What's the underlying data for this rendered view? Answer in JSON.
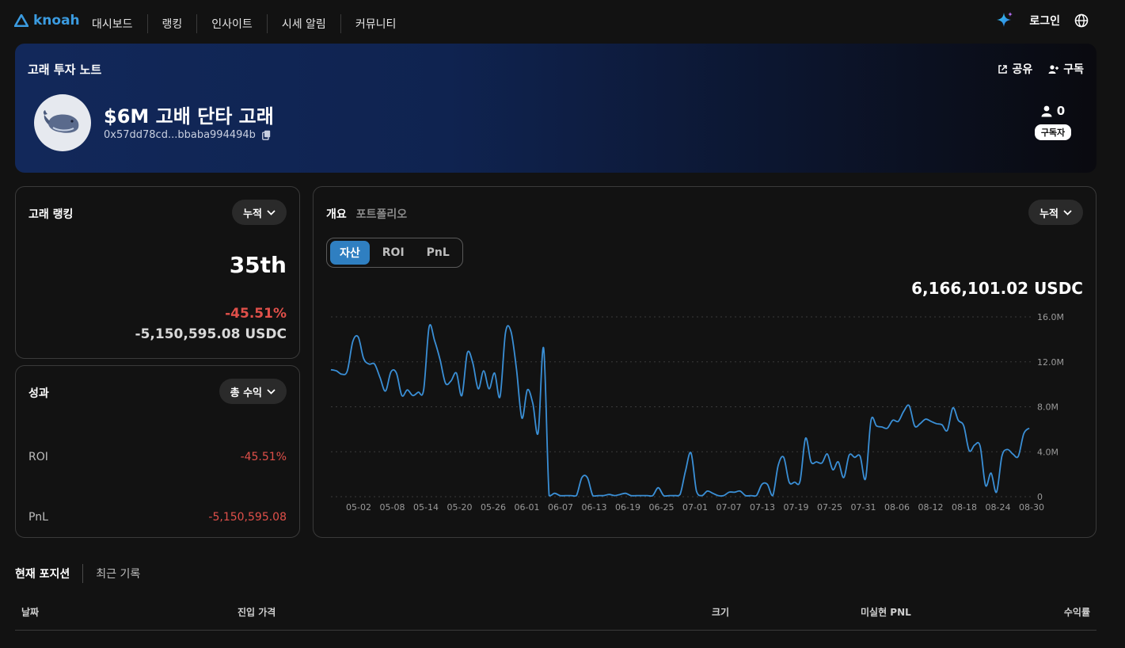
{
  "nav": {
    "brand": "knoah",
    "items": [
      "대시보드",
      "랭킹",
      "인사이트",
      "시세 알림",
      "커뮤니티"
    ],
    "login": "로그인"
  },
  "banner": {
    "title": "고래 투자 노트",
    "share": "공유",
    "subscribe": "구독",
    "whale_name": "$6M 고배 단타 고래",
    "address": "0x57dd78cd...bbaba994494b",
    "subscriber_count": "0",
    "subscriber_label": "구독자"
  },
  "ranking": {
    "title": "고래 랭킹",
    "filter": "누적",
    "rank": "35th",
    "roi": "-45.51%",
    "pnl": "-5,150,595.08 USDC"
  },
  "performance": {
    "title": "성과",
    "filter": "총 수익",
    "roi_label": "ROI",
    "roi_value": "-45.51%",
    "pnl_label": "PnL",
    "pnl_value": "-5,150,595.08"
  },
  "overview": {
    "tab_active": "개요",
    "tab_inactive": "포트폴리오",
    "filter": "누적",
    "segments": [
      "자산",
      "ROI",
      "PnL"
    ],
    "active_segment": "자산",
    "total": "6,166,101.02 USDC"
  },
  "chart_data": {
    "type": "line",
    "y_tick_labels": [
      "16.0M",
      "12.0M",
      "8.0M",
      "4.0M",
      "0"
    ],
    "y_ticks": [
      16,
      12,
      8,
      4,
      0
    ],
    "ylim": [
      0,
      16
    ],
    "x_tick_labels": [
      "05-02",
      "05-08",
      "05-14",
      "05-20",
      "05-26",
      "06-01",
      "06-07",
      "06-13",
      "06-19",
      "06-25",
      "07-01",
      "07-07",
      "07-13",
      "07-19",
      "07-25",
      "07-31",
      "08-06",
      "08-12",
      "08-18",
      "08-24",
      "08-30"
    ],
    "series": [
      {
        "values": [
          11.3,
          11.2,
          10.9,
          11.2,
          13.8,
          14.2,
          12.3,
          11.8,
          11.8,
          10.6,
          9.4,
          11.1,
          11.0,
          9.0,
          9.5,
          9.0,
          9.3,
          9.5,
          15.1,
          13.9,
          12.2,
          10.1,
          10.3,
          11.0,
          9.0,
          12.8,
          11.9,
          9.6,
          11.2,
          9.6,
          11.0,
          8.9,
          14.6,
          14.7,
          11.4,
          7.0,
          9.5,
          8.3,
          5.7,
          13.2,
          0.1,
          0.3,
          0.1,
          0.1,
          0.1,
          0.1,
          1.7,
          1.7,
          0.1,
          0.1,
          0.1,
          0.2,
          0.1,
          0.2,
          0.3,
          0.1,
          0.1,
          0.1,
          0.1,
          0.1,
          0.8,
          0.1,
          0.1,
          0.1,
          0.2,
          2.3,
          3.9,
          0.5,
          0.1,
          0.5,
          0.3,
          0.1,
          0.1,
          0.4,
          0.4,
          0.5,
          0.1,
          0.1,
          0.1,
          1.1,
          1.1,
          0.1,
          2.8,
          3.5,
          1.3,
          1.3,
          1.4,
          5.2,
          3.1,
          3.1,
          3.0,
          3.8,
          2.4,
          3.1,
          1.7,
          3.7,
          3.5,
          3.6,
          1.6,
          6.8,
          6.3,
          6.2,
          6.1,
          6.8,
          6.7,
          7.6,
          8.1,
          6.3,
          6.5,
          6.9,
          6.7,
          6.5,
          6.4,
          5.9,
          7.9,
          6.8,
          6.3,
          4.1,
          4.6,
          4.5,
          1.0,
          2.1,
          0.4,
          3.6,
          4.2,
          3.8,
          3.6,
          5.6,
          6.1
        ]
      }
    ]
  },
  "positions": {
    "tab_active": "현재 포지션",
    "tab_inactive": "최근 기록",
    "columns": [
      "날짜",
      "진입 가격",
      "크기",
      "미실현 PNL",
      "수익률"
    ]
  },
  "colors": {
    "accent": "#2f7fc1",
    "line": "#3a8fd6",
    "negative": "#e0504a"
  }
}
